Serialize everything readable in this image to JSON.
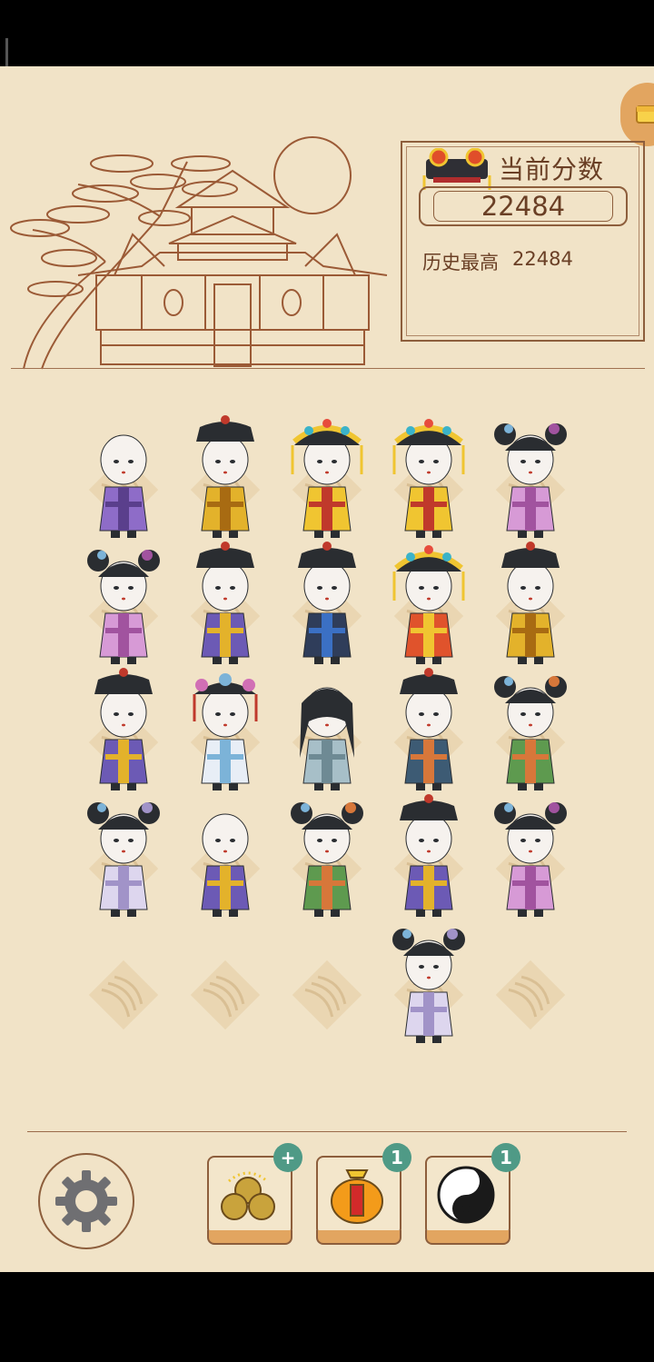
{
  "score_panel": {
    "title": "当前分数",
    "score": "22484",
    "best_label": "历史最高",
    "best_value": "22484"
  },
  "board": {
    "rows": [
      [
        {
          "type": "eunuch",
          "robe": "#8e6cc8",
          "trim": "#5a3f8c"
        },
        {
          "type": "official",
          "robe": "#e3b22b",
          "trim": "#a86b12"
        },
        {
          "type": "empress",
          "robe": "#f0c531",
          "trim": "#c0392b"
        },
        {
          "type": "empress",
          "robe": "#f0c531",
          "trim": "#c0392b"
        },
        {
          "type": "maid",
          "robe": "#d79ad6",
          "trim": "#a1539f"
        }
      ],
      [
        {
          "type": "maid",
          "robe": "#d79ad6",
          "trim": "#a1539f"
        },
        {
          "type": "official",
          "robe": "#6c5ab5",
          "trim": "#e3b22b"
        },
        {
          "type": "official",
          "robe": "#2f3d5a",
          "trim": "#3b70c4"
        },
        {
          "type": "empress",
          "robe": "#e0532c",
          "trim": "#f0c531"
        },
        {
          "type": "official",
          "robe": "#e3b22b",
          "trim": "#a86b12"
        }
      ],
      [
        {
          "type": "official",
          "robe": "#6c5ab5",
          "trim": "#e3b22b"
        },
        {
          "type": "consort",
          "robe": "#e8eef6",
          "trim": "#7cb3d8"
        },
        {
          "type": "scholar",
          "robe": "#a7bfc8",
          "trim": "#6e8a94"
        },
        {
          "type": "official",
          "robe": "#3d5b74",
          "trim": "#d7773a"
        },
        {
          "type": "maid",
          "robe": "#5e9a4f",
          "trim": "#d7773a"
        }
      ],
      [
        {
          "type": "maid",
          "robe": "#ddd6ee",
          "trim": "#a193c8"
        },
        {
          "type": "eunuch",
          "robe": "#6c5ab5",
          "trim": "#e3b22b"
        },
        {
          "type": "maid",
          "robe": "#5e9a4f",
          "trim": "#d7773a"
        },
        {
          "type": "official",
          "robe": "#6c5ab5",
          "trim": "#e3b22b"
        },
        {
          "type": "maid",
          "robe": "#d79ad6",
          "trim": "#a1539f"
        }
      ],
      [
        null,
        null,
        null,
        {
          "type": "maid",
          "robe": "#ddd6ee",
          "trim": "#a193c8"
        },
        null
      ]
    ]
  },
  "tools": [
    {
      "name": "coins",
      "badge": "+"
    },
    {
      "name": "lantern-jar",
      "badge": "1"
    },
    {
      "name": "yin-yang",
      "badge": "1"
    }
  ],
  "colors": {
    "paper": "#f1e3c7",
    "ink": "#8d5e3c",
    "badge": "#4f9a86"
  }
}
